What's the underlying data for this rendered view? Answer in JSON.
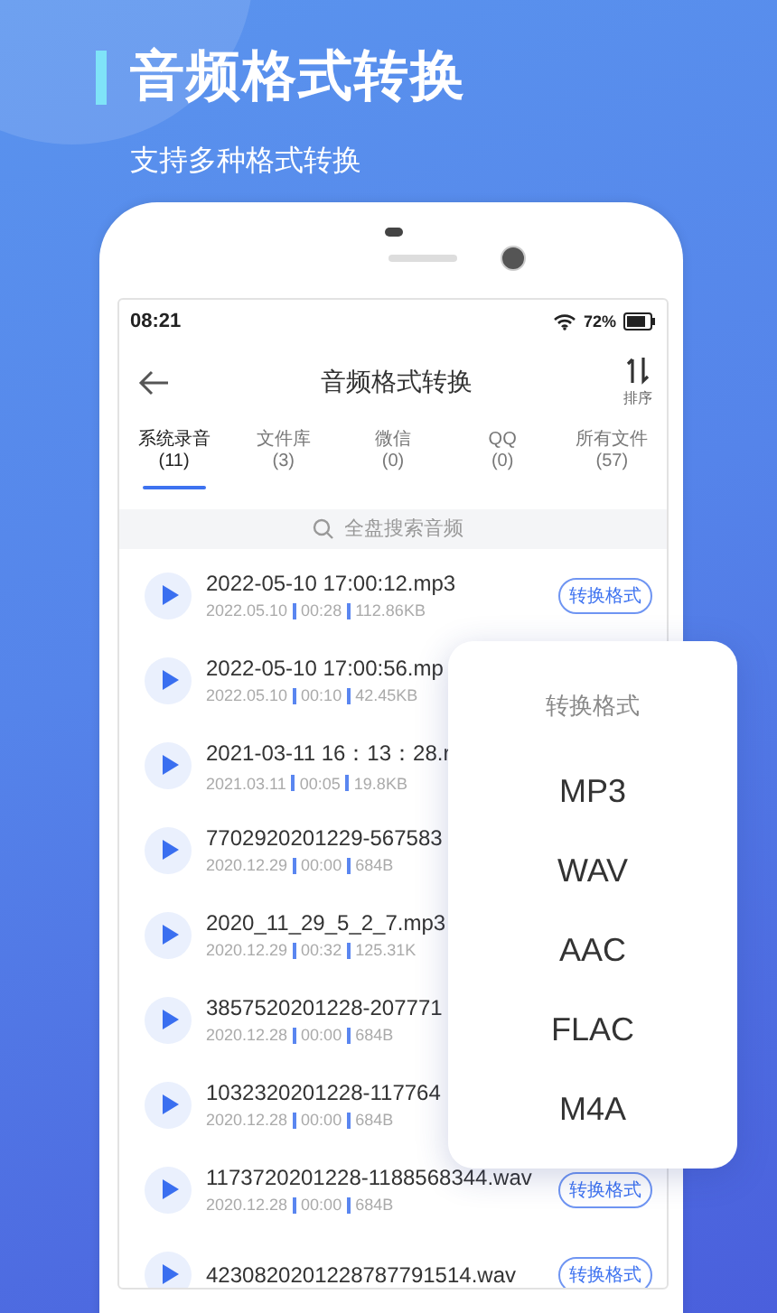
{
  "banner": {
    "title": "音频格式转换",
    "subtitle": "支持多种格式转换"
  },
  "status_bar": {
    "time": "08:21",
    "battery": "72%"
  },
  "header": {
    "title": "音频格式转换",
    "sort_label": "排序"
  },
  "tabs": [
    {
      "label": "系统录音",
      "count": "(11)",
      "selected": true
    },
    {
      "label": "文件库",
      "count": "(3)",
      "selected": false
    },
    {
      "label": "微信",
      "count": "(0)",
      "selected": false
    },
    {
      "label": "QQ",
      "count": "(0)",
      "selected": false
    },
    {
      "label": "所有文件",
      "count": "(57)",
      "selected": false
    }
  ],
  "search": {
    "placeholder": "全盘搜索音频"
  },
  "files": [
    {
      "name": "2022-05-10 17:00:12.mp3",
      "meta": [
        "2022.05.10",
        "00:28",
        "112.86KB"
      ],
      "convert": "转换格式"
    },
    {
      "name": "2022-05-10 17:00:56.mp",
      "meta": [
        "2022.05.10",
        "00:10",
        "42.45KB"
      ]
    },
    {
      "name": "2021-03-11 16：13：28.r",
      "meta": [
        "2021.03.11",
        "00:05",
        "19.8KB"
      ]
    },
    {
      "name": "7702920201229-567583",
      "meta": [
        "2020.12.29",
        "00:00",
        "684B"
      ]
    },
    {
      "name": "2020_11_29_5_2_7.mp3",
      "meta": [
        "2020.12.29",
        "00:32",
        "125.31K"
      ]
    },
    {
      "name": "3857520201228-207771",
      "meta": [
        "2020.12.28",
        "00:00",
        "684B"
      ]
    },
    {
      "name": "1032320201228-117764",
      "meta": [
        "2020.12.28",
        "00:00",
        "684B"
      ]
    },
    {
      "name": "1173720201228-1188568344.wav",
      "meta": [
        "2020.12.28",
        "00:00",
        "684B"
      ],
      "convert": "转换格式"
    },
    {
      "name": "4230820201228787791514.wav",
      "convert": "转换格式"
    }
  ],
  "format_menu": {
    "title": "转换格式",
    "options": [
      "MP3",
      "WAV",
      "AAC",
      "FLAC",
      "M4A"
    ]
  }
}
